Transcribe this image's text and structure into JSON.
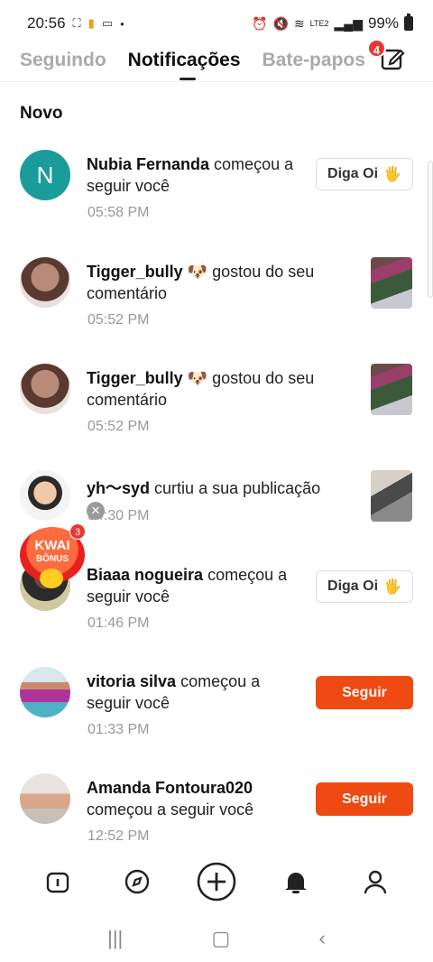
{
  "status_bar": {
    "time": "20:56",
    "icons_left": [
      "screenshot-icon",
      "app-icon",
      "monitor-icon",
      "dot-icon"
    ],
    "icons_right": [
      "alarm-icon",
      "mute-icon",
      "wifi-icon",
      "signal-icon"
    ],
    "network": "LTE2",
    "battery": "99%"
  },
  "tabs": [
    {
      "label": "Seguindo",
      "active": false
    },
    {
      "label": "Notificações",
      "active": true
    },
    {
      "label": "Bate-papos",
      "active": false
    }
  ],
  "compose_badge": "4",
  "section_title": "Novo",
  "notifications": [
    {
      "name": "Nubia Fernanda",
      "action": "começou a seguir você",
      "time": "05:58 PM",
      "avatar": "N",
      "button": "Diga Oi",
      "button_emoji": "🖐"
    },
    {
      "name": "Tigger_bully",
      "emoji": "🐶",
      "action": "gostou do seu comentário",
      "time": "05:52 PM"
    },
    {
      "name": "Tigger_bully",
      "emoji": "🐶",
      "action": "gostou do seu comentário",
      "time": "05:52 PM"
    },
    {
      "name": "yh～syd",
      "action": "curtiu a sua publicação",
      "time": "04:30 PM"
    },
    {
      "name": "Biaaa nogueira",
      "action": "começou a seguir você",
      "time": "01:46 PM",
      "button": "Diga Oi",
      "button_emoji": "🖐"
    },
    {
      "name": "vitoria silva",
      "action": "começou a seguir você",
      "time": "01:33 PM",
      "button": "Seguir"
    },
    {
      "name": "Amanda Fontoura020",
      "action": "começou a seguir você",
      "time": "12:52 PM",
      "button": "Seguir"
    }
  ],
  "kwai_promo": {
    "line1": "KWAI",
    "line2": "BÔNUS",
    "badge": "3"
  },
  "colors": {
    "accent": "#ee4a12",
    "badge": "#e53935",
    "avatar_n": "#1a9c9a"
  }
}
